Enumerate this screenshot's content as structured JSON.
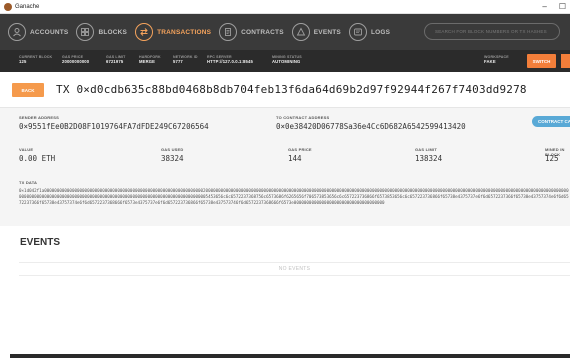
{
  "window": {
    "title": "Ganache"
  },
  "nav": {
    "items": [
      {
        "label": "ACCOUNTS",
        "icon": "accounts-icon"
      },
      {
        "label": "BLOCKS",
        "icon": "blocks-icon"
      },
      {
        "label": "TRANSACTIONS",
        "icon": "transactions-icon",
        "active": true
      },
      {
        "label": "CONTRACTS",
        "icon": "contracts-icon"
      },
      {
        "label": "EVENTS",
        "icon": "events-icon"
      },
      {
        "label": "LOGS",
        "icon": "logs-icon"
      }
    ],
    "search_placeholder": "SEARCH FOR BLOCK NUMBERS OR TX HASHES"
  },
  "status": {
    "current_block": {
      "label": "CURRENT BLOCK",
      "value": "125"
    },
    "gas_price": {
      "label": "GAS PRICE",
      "value": "20000000000"
    },
    "gas_limit": {
      "label": "GAS LIMIT",
      "value": "6721975"
    },
    "hardfork": {
      "label": "HARDFORK",
      "value": "MERGE"
    },
    "network_id": {
      "label": "NETWORK ID",
      "value": "5777"
    },
    "rpc_server": {
      "label": "RPC SERVER",
      "value": "HTTP://127.0.0.1:8545"
    },
    "mining_status": {
      "label": "MINING STATUS",
      "value": "AUTOMINING"
    },
    "workspace": {
      "label": "WORKSPACE",
      "value": "FAKE"
    },
    "switch_label": "SWITCH"
  },
  "tx": {
    "back_label": "BACK",
    "hash": "TX 0×d0cdb635c88bd0468b8db704feb13f6da64d69b2d97f92944f267f7403dd9278",
    "sender_label": "SENDER ADDRESS",
    "sender": "0×9551fEe0B2D08F1019764FA7dFDE249C67206564",
    "to_label": "TO CONTRACT ADDRESS",
    "to": "0×0e38420D06778Sa36e4Cc6D682A6542599413420",
    "badge": "CONTRACT CALL",
    "value_label": "VALUE",
    "value": "0.00 ETH",
    "gas_used_label": "GAS USED",
    "gas_used": "38324",
    "gas_price_label": "GAS PRICE",
    "gas_price": "144",
    "gas_limit_label": "GAS LIMIT",
    "gas_limit": "138324",
    "mined_label": "MINED IN BLOCK",
    "mined": "125",
    "data_label": "TX DATA",
    "data": "0×1d042f1a0000000000000000000000000000000000000000000000000000000000000002000000000000000000000000000000000000000000000000000000000000000000000000000000000000000000000000000000000000000000000000000000000000000000000000000000000000000000000000000000000000000000000000000000000000000000000000005453656c6c6572237368756c6573686f6265656f706573853656c6c657223736866f6573853656c6c657223736866f65738e4375737e6f6d6572237366f65738e43757374e6f6d6572237366f65738e43757374e6f6d6572237368666f6573e4375737e6f6d657223736866f65738e437573746f6d6572237368666f6573e000000000000000000000000000000000000"
  },
  "events": {
    "title": "EVENTS",
    "empty": "NO EVENTS"
  }
}
